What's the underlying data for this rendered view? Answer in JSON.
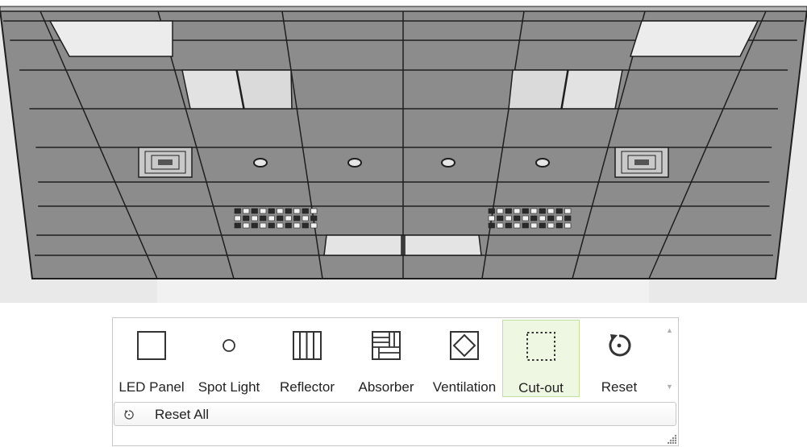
{
  "viewport": {
    "scene": "ceiling-grid-3d-view",
    "colors": {
      "tile": "#8c8c8c",
      "grid": "#1e1e1e",
      "wall": "#ececec",
      "panel": "#dadada"
    }
  },
  "ribbon": {
    "tools": [
      {
        "label": "LED Panel",
        "icon": "led-panel-icon"
      },
      {
        "label": "Spot Light",
        "icon": "spot-light-icon"
      },
      {
        "label": "Reflector",
        "icon": "reflector-icon"
      },
      {
        "label": "Absorber",
        "icon": "absorber-icon"
      },
      {
        "label": "Ventilation",
        "icon": "ventilation-icon"
      },
      {
        "label": "Cut-out",
        "icon": "cut-out-icon",
        "selected": true
      },
      {
        "label": "Reset",
        "icon": "reset-icon"
      }
    ],
    "reset_all": {
      "label": "Reset All",
      "icon": "reset-icon"
    },
    "colors": {
      "active_bg": "#edf7e2",
      "active_border": "#bfe0a0"
    }
  }
}
